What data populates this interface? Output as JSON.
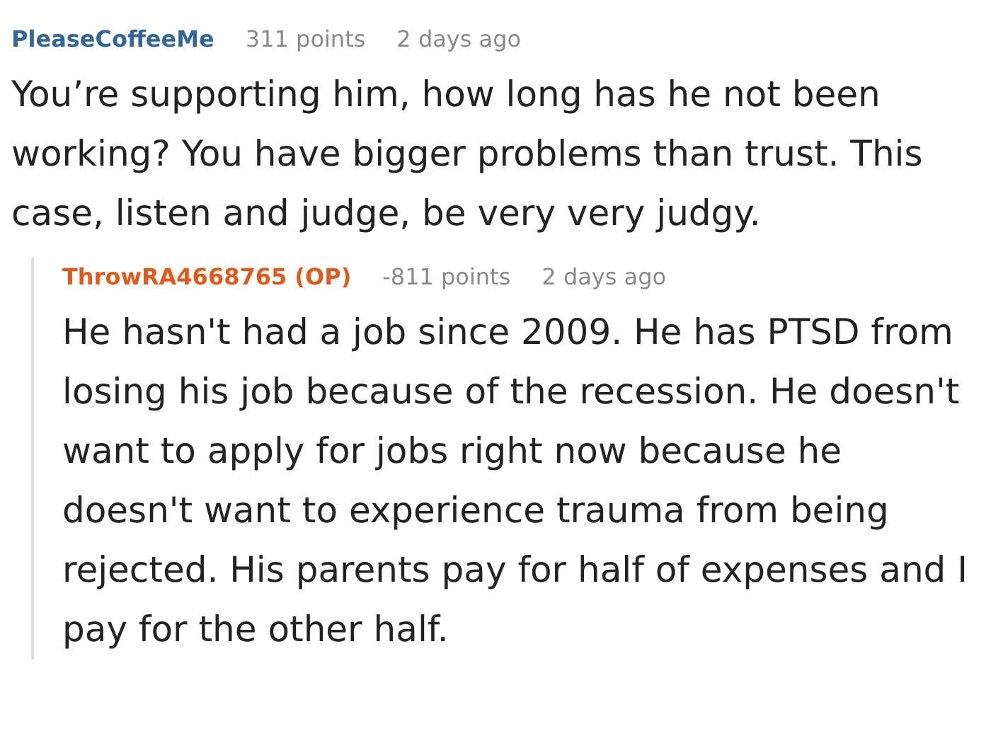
{
  "comments": [
    {
      "username": "PleaseCoffeeMe",
      "kind": "normal",
      "points": "311 points",
      "time": "2 days ago",
      "body": "You’re supporting him, how long has he not been working? You have bigger problems than trust. This case, listen and judge, be very very judgy.",
      "replies": [
        {
          "username": "ThrowRA4668765 (OP)",
          "kind": "op",
          "points": "-811 points",
          "time": "2 days ago",
          "body": "He hasn't had a job since 2009. He has PTSD from losing his job because of the recession. He doesn't want to apply for jobs right now because he doesn't want to experience trauma from being rejected. His parents pay for half of expenses and I pay for the other half."
        }
      ]
    }
  ]
}
